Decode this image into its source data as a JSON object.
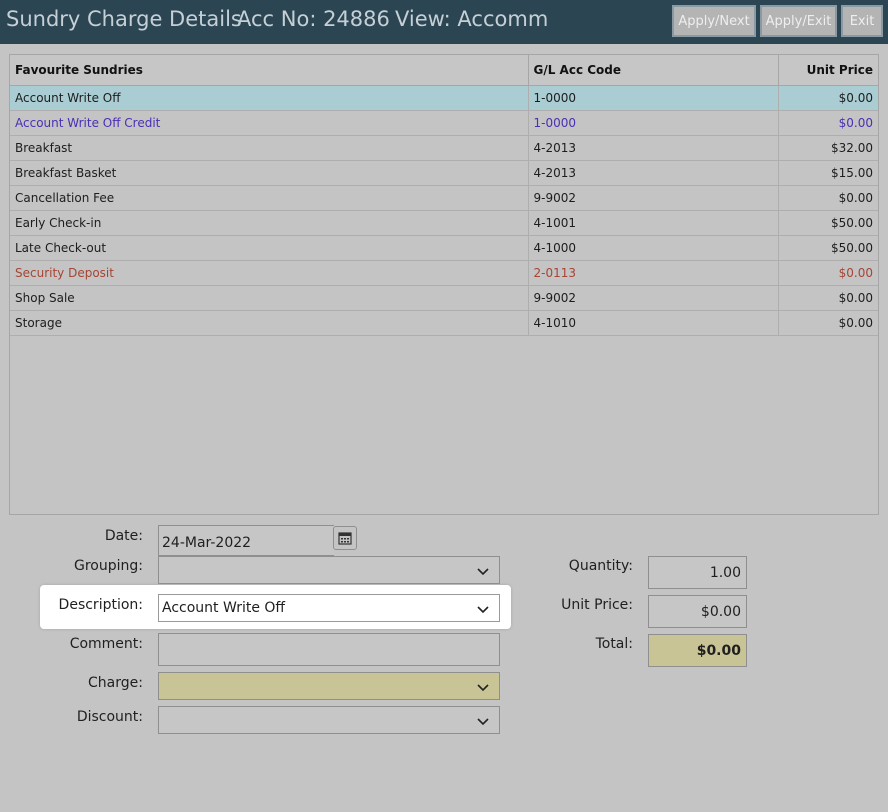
{
  "header": {
    "title": "Sundry Charge Details",
    "acc_no": "Acc No: 24886",
    "view": "View: Accomm",
    "buttons": {
      "apply_next": "Apply/Next",
      "apply_exit": "Apply/Exit",
      "exit": "Exit"
    }
  },
  "grid": {
    "columns": [
      "Favourite Sundries",
      "G/L Acc Code",
      "Unit Price"
    ],
    "rows": [
      {
        "name": "Account Write Off",
        "code": "1-0000",
        "price": "$0.00",
        "state": "selected"
      },
      {
        "name": "Account Write Off Credit",
        "code": "1-0000",
        "price": "$0.00",
        "state": "credit"
      },
      {
        "name": "Breakfast",
        "code": "4-2013",
        "price": "$32.00",
        "state": ""
      },
      {
        "name": "Breakfast Basket",
        "code": "4-2013",
        "price": "$15.00",
        "state": ""
      },
      {
        "name": "Cancellation Fee",
        "code": "9-9002",
        "price": "$0.00",
        "state": ""
      },
      {
        "name": "Early Check-in",
        "code": "4-1001",
        "price": "$50.00",
        "state": ""
      },
      {
        "name": "Late Check-out",
        "code": "4-1000",
        "price": "$50.00",
        "state": ""
      },
      {
        "name": "Security Deposit",
        "code": "2-0113",
        "price": "$0.00",
        "state": "deposit"
      },
      {
        "name": "Shop Sale",
        "code": "9-9002",
        "price": "$0.00",
        "state": ""
      },
      {
        "name": "Storage",
        "code": "4-1010",
        "price": "$0.00",
        "state": ""
      }
    ]
  },
  "form": {
    "date_label": "Date:",
    "date_value": "24-Mar-2022",
    "grouping_label": "Grouping:",
    "grouping_value": "",
    "description_label": "Description:",
    "description_value": "Account Write Off",
    "comment_label": "Comment:",
    "comment_value": "",
    "charge_label": "Charge:",
    "charge_value": "",
    "discount_label": "Discount:",
    "discount_value": "",
    "quantity_label": "Quantity:",
    "quantity_value": "1.00",
    "unit_price_label": "Unit Price:",
    "unit_price_value": "$0.00",
    "total_label": "Total:",
    "total_value": "$0.00"
  },
  "colors": {
    "header_bg": "#2c4553",
    "selected_row": "#a9cdd3",
    "credit_text": "#4b2fb4",
    "deposit_text": "#a64535",
    "gold_field": "#c9c496"
  },
  "icons": {
    "calendar": "calendar-icon",
    "dropdown": "chevron-down-icon"
  }
}
